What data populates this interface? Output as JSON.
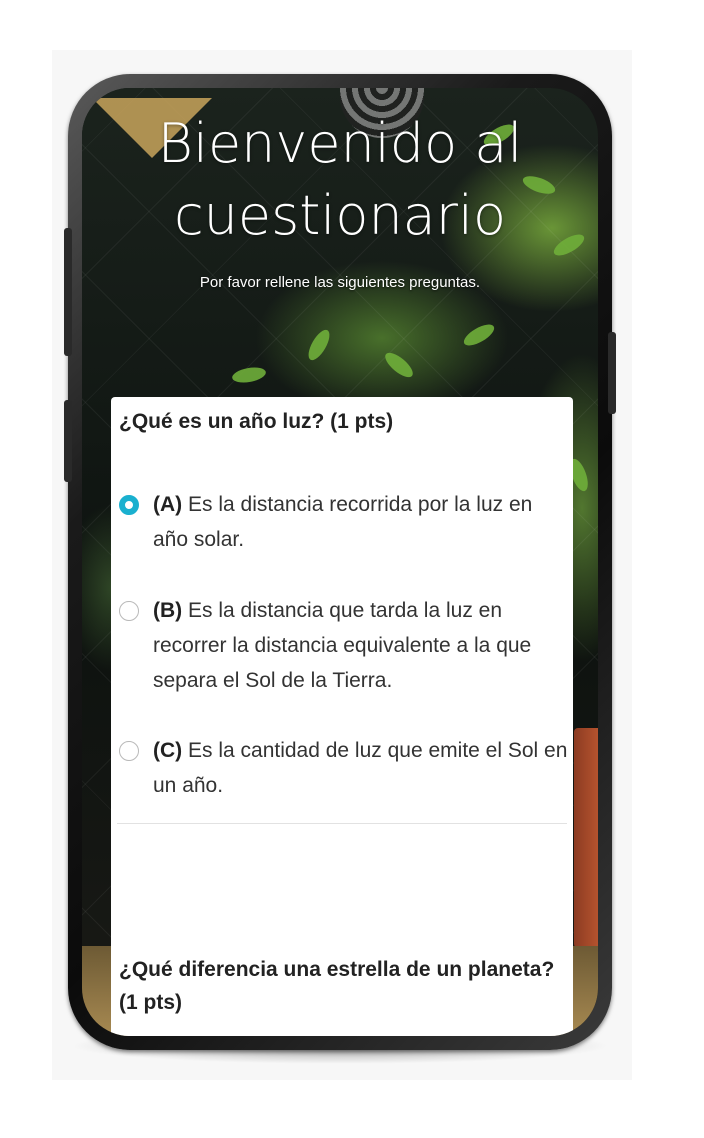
{
  "hero": {
    "title_line1": "Bienvenido al",
    "title_line2": "cuestionario",
    "subtitle": "Por favor rellene las siguientes preguntas."
  },
  "questions": [
    {
      "title": "¿Qué es un año luz? (1 pts)",
      "options": [
        {
          "letter": "(A)",
          "text": " Es la distancia recorrida por la luz en año solar.",
          "selected": true
        },
        {
          "letter": "(B)",
          "text": " Es la distancia que tarda la luz en recorrer la distancia equivalente a la que separa el Sol de la Tierra.",
          "selected": false
        },
        {
          "letter": "(C)",
          "text": " Es la cantidad de luz que emite el Sol en un año.",
          "selected": false
        }
      ]
    },
    {
      "title": "¿Qué diferencia una estrella de un planeta? (1 pts)"
    }
  ],
  "colors": {
    "accent": "#1ab0cf",
    "card_bg": "#ffffff",
    "text": "#333333"
  }
}
